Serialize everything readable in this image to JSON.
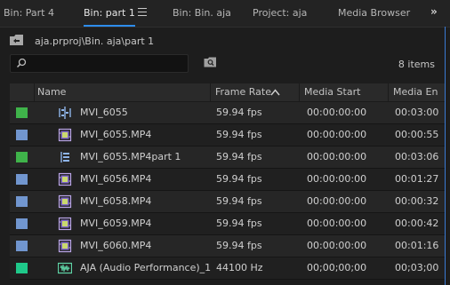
{
  "tabs": [
    {
      "label": "Bin: Part 4"
    },
    {
      "label": "Bin: part 1"
    },
    {
      "label": "Bin: Bin. aja"
    },
    {
      "label": "Project: aja"
    },
    {
      "label": "Media Browser"
    }
  ],
  "more_label": "»",
  "path": "aja.prproj\\Bin. aja\\part 1",
  "search": {
    "placeholder": "",
    "value": ""
  },
  "item_count": "8 items",
  "columns": [
    {
      "label": "Name"
    },
    {
      "label": "Frame Rate"
    },
    {
      "label": "Media Start"
    },
    {
      "label": "Media En"
    }
  ],
  "colors": {
    "green": "#3fb34a",
    "blue": "#7196cf",
    "teal": "#1fc98a",
    "accent": "#2d8ceb"
  },
  "rows": [
    {
      "label_color": "green",
      "icon": "multicam-sequence-icon",
      "name": "MVI_6055",
      "frame_rate": "59.94 fps",
      "media_start": "00:00:00:00",
      "media_end": "00:03:00"
    },
    {
      "label_color": "blue",
      "icon": "video-clip-icon",
      "name": "MVI_6055.MP4",
      "frame_rate": "59.94 fps",
      "media_start": "00:00:00:00",
      "media_end": "00:00:55"
    },
    {
      "label_color": "green",
      "icon": "sequence-icon",
      "name": "MVI_6055.MP4part 1",
      "frame_rate": "59.94 fps",
      "media_start": "00:00:00:00",
      "media_end": "00:03:06"
    },
    {
      "label_color": "blue",
      "icon": "video-clip-icon",
      "name": "MVI_6056.MP4",
      "frame_rate": "59.94 fps",
      "media_start": "00:00:00:00",
      "media_end": "00:01:27"
    },
    {
      "label_color": "blue",
      "icon": "video-clip-icon",
      "name": "MVI_6058.MP4",
      "frame_rate": "59.94 fps",
      "media_start": "00:00:00:00",
      "media_end": "00:00:32"
    },
    {
      "label_color": "blue",
      "icon": "video-clip-icon",
      "name": "MVI_6059.MP4",
      "frame_rate": "59.94 fps",
      "media_start": "00:00:00:00",
      "media_end": "00:00:42"
    },
    {
      "label_color": "blue",
      "icon": "video-clip-icon",
      "name": "MVI_6060.MP4",
      "frame_rate": "59.94 fps",
      "media_start": "00:00:00:00",
      "media_end": "00:01:16"
    },
    {
      "label_color": "teal",
      "icon": "audio-clip-icon",
      "name": "AJA (Audio Performance)_1.",
      "frame_rate": "44100 Hz",
      "media_start": "00;00;00;00",
      "media_end": "00;03;00"
    }
  ]
}
